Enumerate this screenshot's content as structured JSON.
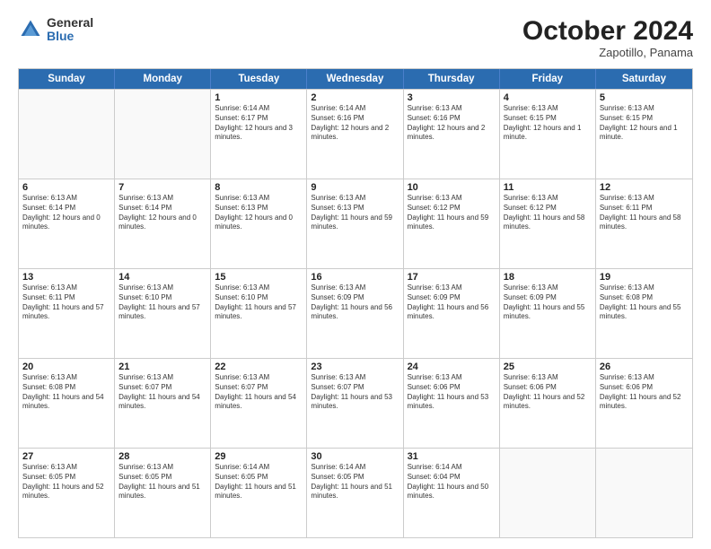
{
  "logo": {
    "general": "General",
    "blue": "Blue"
  },
  "header": {
    "month": "October 2024",
    "location": "Zapotillo, Panama"
  },
  "weekdays": [
    "Sunday",
    "Monday",
    "Tuesday",
    "Wednesday",
    "Thursday",
    "Friday",
    "Saturday"
  ],
  "rows": [
    [
      {
        "day": "",
        "sunrise": "",
        "sunset": "",
        "daylight": ""
      },
      {
        "day": "",
        "sunrise": "",
        "sunset": "",
        "daylight": ""
      },
      {
        "day": "1",
        "sunrise": "Sunrise: 6:14 AM",
        "sunset": "Sunset: 6:17 PM",
        "daylight": "Daylight: 12 hours and 3 minutes."
      },
      {
        "day": "2",
        "sunrise": "Sunrise: 6:14 AM",
        "sunset": "Sunset: 6:16 PM",
        "daylight": "Daylight: 12 hours and 2 minutes."
      },
      {
        "day": "3",
        "sunrise": "Sunrise: 6:13 AM",
        "sunset": "Sunset: 6:16 PM",
        "daylight": "Daylight: 12 hours and 2 minutes."
      },
      {
        "day": "4",
        "sunrise": "Sunrise: 6:13 AM",
        "sunset": "Sunset: 6:15 PM",
        "daylight": "Daylight: 12 hours and 1 minute."
      },
      {
        "day": "5",
        "sunrise": "Sunrise: 6:13 AM",
        "sunset": "Sunset: 6:15 PM",
        "daylight": "Daylight: 12 hours and 1 minute."
      }
    ],
    [
      {
        "day": "6",
        "sunrise": "Sunrise: 6:13 AM",
        "sunset": "Sunset: 6:14 PM",
        "daylight": "Daylight: 12 hours and 0 minutes."
      },
      {
        "day": "7",
        "sunrise": "Sunrise: 6:13 AM",
        "sunset": "Sunset: 6:14 PM",
        "daylight": "Daylight: 12 hours and 0 minutes."
      },
      {
        "day": "8",
        "sunrise": "Sunrise: 6:13 AM",
        "sunset": "Sunset: 6:13 PM",
        "daylight": "Daylight: 12 hours and 0 minutes."
      },
      {
        "day": "9",
        "sunrise": "Sunrise: 6:13 AM",
        "sunset": "Sunset: 6:13 PM",
        "daylight": "Daylight: 11 hours and 59 minutes."
      },
      {
        "day": "10",
        "sunrise": "Sunrise: 6:13 AM",
        "sunset": "Sunset: 6:12 PM",
        "daylight": "Daylight: 11 hours and 59 minutes."
      },
      {
        "day": "11",
        "sunrise": "Sunrise: 6:13 AM",
        "sunset": "Sunset: 6:12 PM",
        "daylight": "Daylight: 11 hours and 58 minutes."
      },
      {
        "day": "12",
        "sunrise": "Sunrise: 6:13 AM",
        "sunset": "Sunset: 6:11 PM",
        "daylight": "Daylight: 11 hours and 58 minutes."
      }
    ],
    [
      {
        "day": "13",
        "sunrise": "Sunrise: 6:13 AM",
        "sunset": "Sunset: 6:11 PM",
        "daylight": "Daylight: 11 hours and 57 minutes."
      },
      {
        "day": "14",
        "sunrise": "Sunrise: 6:13 AM",
        "sunset": "Sunset: 6:10 PM",
        "daylight": "Daylight: 11 hours and 57 minutes."
      },
      {
        "day": "15",
        "sunrise": "Sunrise: 6:13 AM",
        "sunset": "Sunset: 6:10 PM",
        "daylight": "Daylight: 11 hours and 57 minutes."
      },
      {
        "day": "16",
        "sunrise": "Sunrise: 6:13 AM",
        "sunset": "Sunset: 6:09 PM",
        "daylight": "Daylight: 11 hours and 56 minutes."
      },
      {
        "day": "17",
        "sunrise": "Sunrise: 6:13 AM",
        "sunset": "Sunset: 6:09 PM",
        "daylight": "Daylight: 11 hours and 56 minutes."
      },
      {
        "day": "18",
        "sunrise": "Sunrise: 6:13 AM",
        "sunset": "Sunset: 6:09 PM",
        "daylight": "Daylight: 11 hours and 55 minutes."
      },
      {
        "day": "19",
        "sunrise": "Sunrise: 6:13 AM",
        "sunset": "Sunset: 6:08 PM",
        "daylight": "Daylight: 11 hours and 55 minutes."
      }
    ],
    [
      {
        "day": "20",
        "sunrise": "Sunrise: 6:13 AM",
        "sunset": "Sunset: 6:08 PM",
        "daylight": "Daylight: 11 hours and 54 minutes."
      },
      {
        "day": "21",
        "sunrise": "Sunrise: 6:13 AM",
        "sunset": "Sunset: 6:07 PM",
        "daylight": "Daylight: 11 hours and 54 minutes."
      },
      {
        "day": "22",
        "sunrise": "Sunrise: 6:13 AM",
        "sunset": "Sunset: 6:07 PM",
        "daylight": "Daylight: 11 hours and 54 minutes."
      },
      {
        "day": "23",
        "sunrise": "Sunrise: 6:13 AM",
        "sunset": "Sunset: 6:07 PM",
        "daylight": "Daylight: 11 hours and 53 minutes."
      },
      {
        "day": "24",
        "sunrise": "Sunrise: 6:13 AM",
        "sunset": "Sunset: 6:06 PM",
        "daylight": "Daylight: 11 hours and 53 minutes."
      },
      {
        "day": "25",
        "sunrise": "Sunrise: 6:13 AM",
        "sunset": "Sunset: 6:06 PM",
        "daylight": "Daylight: 11 hours and 52 minutes."
      },
      {
        "day": "26",
        "sunrise": "Sunrise: 6:13 AM",
        "sunset": "Sunset: 6:06 PM",
        "daylight": "Daylight: 11 hours and 52 minutes."
      }
    ],
    [
      {
        "day": "27",
        "sunrise": "Sunrise: 6:13 AM",
        "sunset": "Sunset: 6:05 PM",
        "daylight": "Daylight: 11 hours and 52 minutes."
      },
      {
        "day": "28",
        "sunrise": "Sunrise: 6:13 AM",
        "sunset": "Sunset: 6:05 PM",
        "daylight": "Daylight: 11 hours and 51 minutes."
      },
      {
        "day": "29",
        "sunrise": "Sunrise: 6:14 AM",
        "sunset": "Sunset: 6:05 PM",
        "daylight": "Daylight: 11 hours and 51 minutes."
      },
      {
        "day": "30",
        "sunrise": "Sunrise: 6:14 AM",
        "sunset": "Sunset: 6:05 PM",
        "daylight": "Daylight: 11 hours and 51 minutes."
      },
      {
        "day": "31",
        "sunrise": "Sunrise: 6:14 AM",
        "sunset": "Sunset: 6:04 PM",
        "daylight": "Daylight: 11 hours and 50 minutes."
      },
      {
        "day": "",
        "sunrise": "",
        "sunset": "",
        "daylight": ""
      },
      {
        "day": "",
        "sunrise": "",
        "sunset": "",
        "daylight": ""
      }
    ]
  ]
}
